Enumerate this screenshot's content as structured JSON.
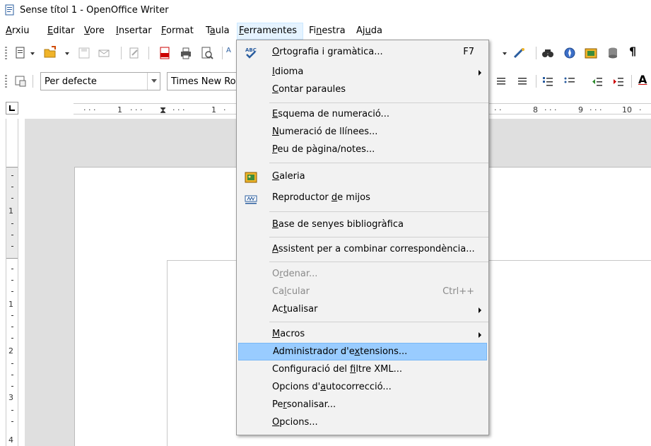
{
  "window": {
    "title": "Sense títol 1 - OpenOffice Writer"
  },
  "menubar": [
    {
      "label": "Arxiu",
      "ul": 0
    },
    {
      "label": "Editar",
      "ul": 0
    },
    {
      "label": "Vore",
      "ul": 0
    },
    {
      "label": "Insertar",
      "ul": 0
    },
    {
      "label": "Format",
      "ul": 0
    },
    {
      "label": "Taula",
      "ul": 1
    },
    {
      "label": "Ferramentes",
      "ul": 0
    },
    {
      "label": "Finestra",
      "ul": 2
    },
    {
      "label": "Ajuda",
      "ul": 2
    }
  ],
  "toolbar2": {
    "style_value": "Per defecte",
    "font_value": "Times New Ro"
  },
  "ruler": {
    "h_ticks": [
      "1",
      "1",
      "8",
      "9",
      "10"
    ],
    "v_ticks": [
      "1",
      "1",
      "2",
      "3",
      "4"
    ]
  },
  "menu": {
    "items": [
      {
        "label": "Ortografia i gramàtica...",
        "ul": 0,
        "shortcut": "F7",
        "icon": "spellcheck-icon"
      },
      {
        "label": "Idioma",
        "ul": 0,
        "submenu": true
      },
      {
        "label": "Contar paraules",
        "ul": 0
      },
      {
        "label": "Esquema de numeració...",
        "ul": 0
      },
      {
        "label": "Numeració de llínees...",
        "ul": 0
      },
      {
        "label": "Peu de pàgina/notes...",
        "ul": 0
      },
      {
        "label": "Galeria",
        "ul": 0,
        "icon": "gallery-icon"
      },
      {
        "label": "Reproductor de mijos",
        "ul": 12,
        "icon": "media-player-icon"
      },
      {
        "label": "Base de senyes bibliogràfica",
        "ul": 0
      },
      {
        "label": "Assistent per a combinar correspondència...",
        "ul": 0
      },
      {
        "label": "Ordenar...",
        "ul": 1,
        "disabled": true
      },
      {
        "label": "Calcular",
        "ul": 2,
        "shortcut": "Ctrl++",
        "disabled": true
      },
      {
        "label": "Actualisar",
        "ul": 2,
        "submenu": true
      },
      {
        "label": "Macros",
        "ul": 0,
        "submenu": true
      },
      {
        "label": "Administrador d'extensions...",
        "ul": 17,
        "highlighted": true
      },
      {
        "label": "Configuració del filtre XML...",
        "ul": 17
      },
      {
        "label": "Opcions d'autocorrecció...",
        "ul": 10
      },
      {
        "label": "Personalisar...",
        "ul": 2
      },
      {
        "label": "Opcions...",
        "ul": 0
      }
    ]
  },
  "colors": {
    "menu_highlight": "#99ccff",
    "menu_bg": "#f2f2f2",
    "workspace": "#dfdfdf"
  }
}
